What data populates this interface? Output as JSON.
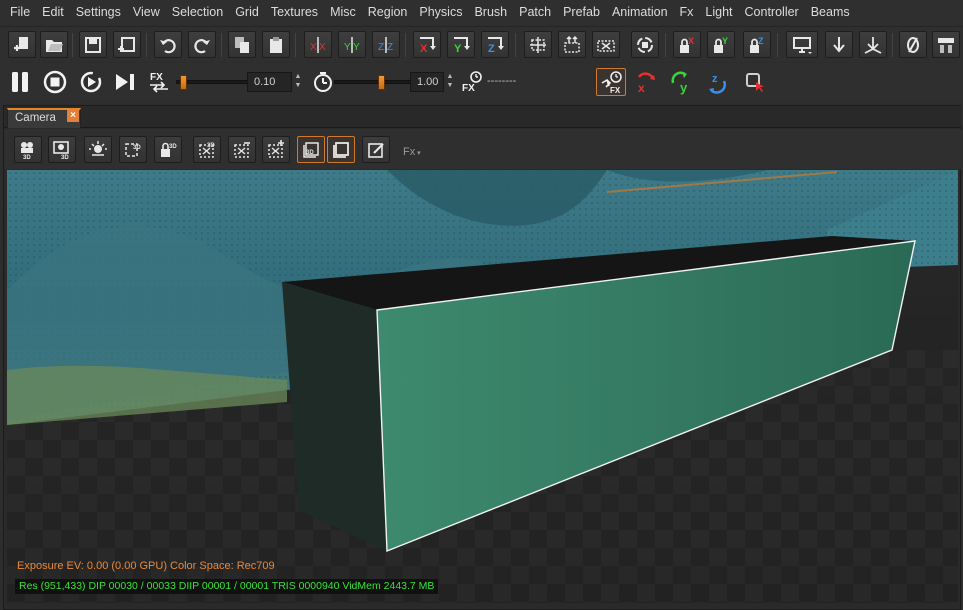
{
  "menu": [
    "File",
    "Edit",
    "Settings",
    "View",
    "Selection",
    "Grid",
    "Textures",
    "Misc",
    "Region",
    "Physics",
    "Brush",
    "Patch",
    "Prefab",
    "Animation",
    "Fx",
    "Light",
    "Controller",
    "Beams"
  ],
  "toolbar": {
    "icons": [
      "new-icon",
      "open-icon",
      "save-icon",
      "save-as-icon",
      "undo-icon",
      "redo-icon",
      "copy-icon",
      "paste-icon",
      "flip-x-icon",
      "flip-y-icon",
      "flip-z-icon",
      "rotate-x-icon",
      "rotate-y-icon",
      "rotate-z-icon",
      "csg-merge-icon",
      "csg-split-icon",
      "csg-subtract-icon",
      "cycle-icon",
      "lock-x-icon",
      "lock-y-icon",
      "lock-z-icon",
      "monitor-icon",
      "drop-icon",
      "drop-multiple-icon",
      "null-icon",
      "properties-icon"
    ]
  },
  "playback": {
    "time_scale": "0.10",
    "speed": "1.00",
    "timecode": "--------",
    "time_scale_fraction": 0.05,
    "speed_fraction": 0.62
  },
  "tab": {
    "label": "Camera",
    "close": "×"
  },
  "camera_toolbar": {
    "fx_label": "Fx"
  },
  "viewport": {
    "exposure": "Exposure EV: 0.00 (0.00 GPU)  Color Space: Rec709",
    "stats": "Res (951,433)   DIP 00030 / 00033  DIIP 00001 / 00001  TRIS 0000940  VidMem 2443.7 MB"
  },
  "colors": {
    "accent": "#e6862b",
    "axis_x": "#e53030",
    "axis_y": "#3cd43c",
    "axis_z": "#3a8fe8",
    "stats_green": "#35e335",
    "exposure_orange": "#e8893a"
  }
}
